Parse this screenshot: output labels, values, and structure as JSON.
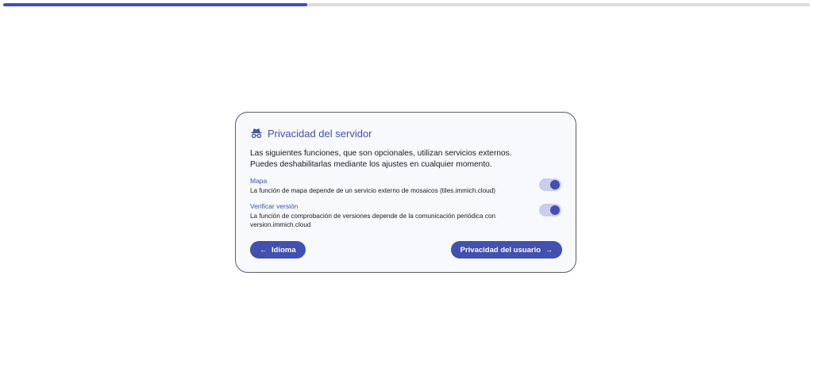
{
  "progress": {
    "value_percent": 37.7,
    "fill_color": "#4250af",
    "track_color": "#dcdcdf"
  },
  "card": {
    "icon": "incognito-icon",
    "title": "Privacidad del servidor",
    "intro": "Las siguientes funciones, que son opcionales, utilizan servicios externos. Puedes deshabilitarlas mediante los ajustes en cualquier momento.",
    "settings": [
      {
        "title": "Mapa",
        "description": "La función de mapa depende de un servicio externo de mosaicos (tiles.immich.cloud)",
        "enabled": true
      },
      {
        "title": "Verificar versión",
        "description": "La función de comprobación de versiones depende de la comunicación periódica con version.immich.cloud",
        "enabled": true
      }
    ]
  },
  "nav": {
    "back_label": "Idioma",
    "back_icon": "arrow-left-icon",
    "next_label": "Privacidad del usuario",
    "next_icon": "arrow-right-icon"
  },
  "colors": {
    "accent": "#4250af",
    "card_background": "#f7f9fc",
    "toggle_track": "#c9cdef"
  }
}
